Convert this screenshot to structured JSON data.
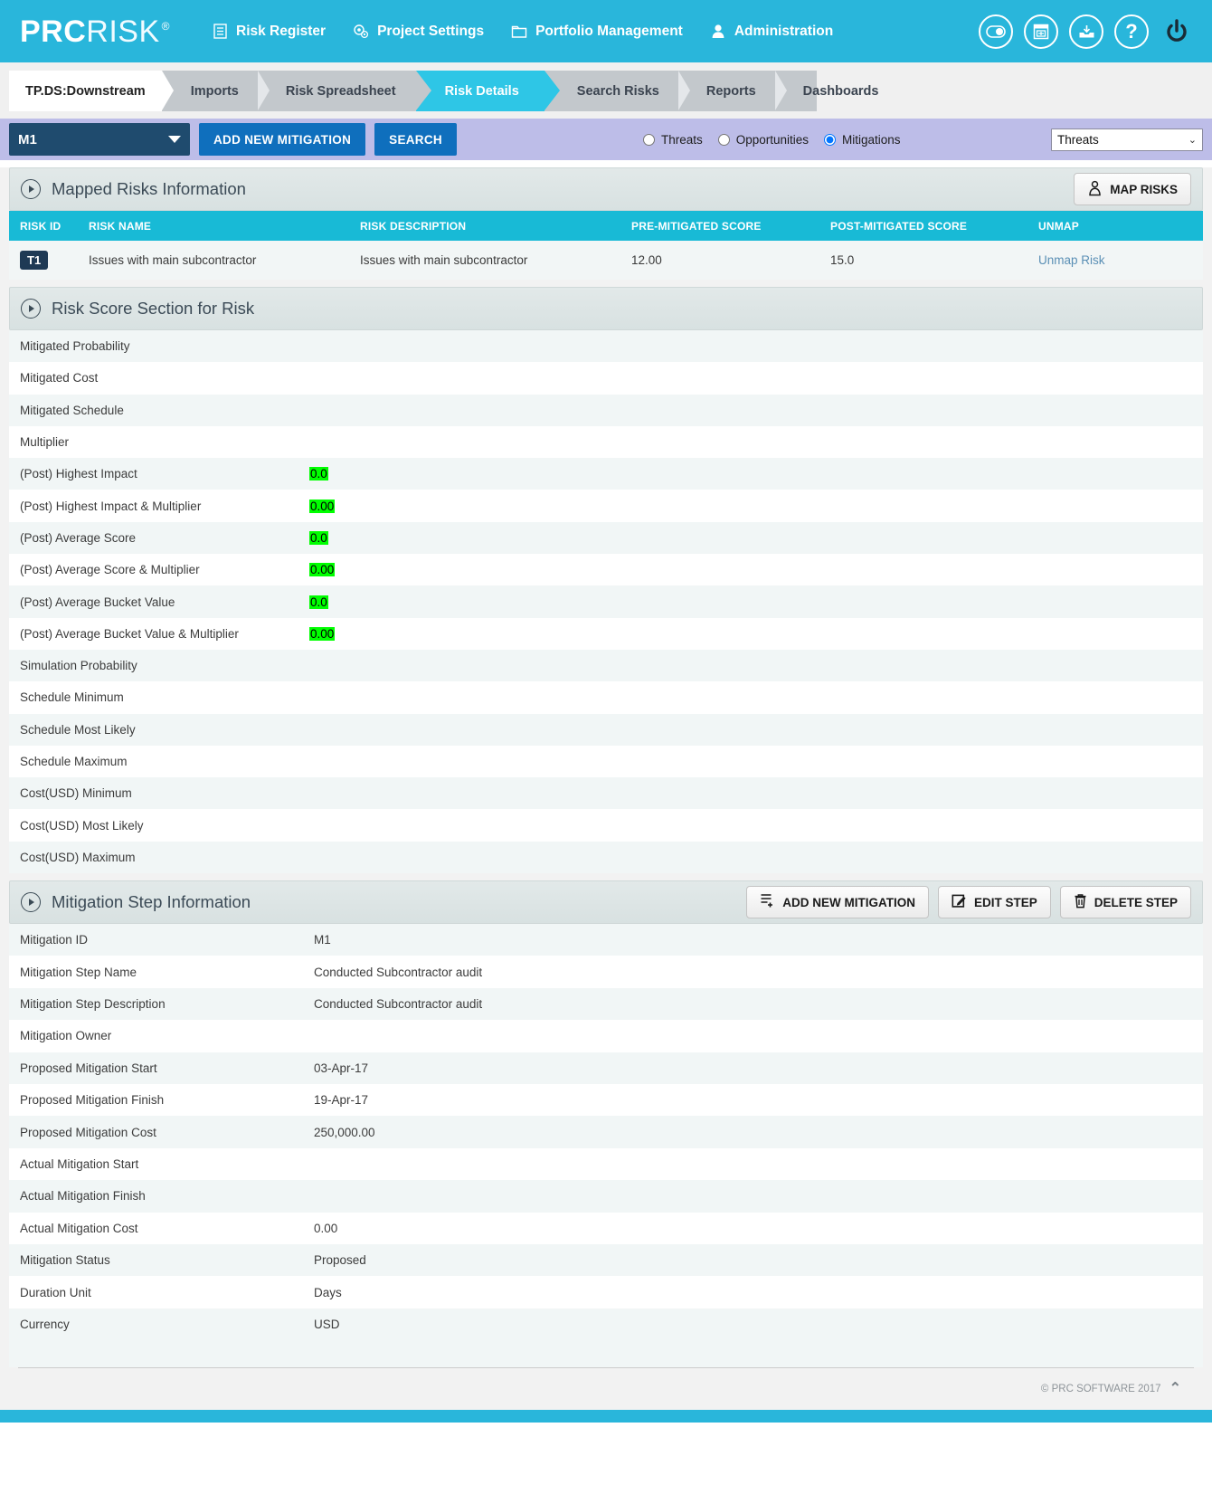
{
  "header": {
    "brand_bold": "PRC",
    "brand_light": "RISK",
    "brand_reg": "®",
    "nav": [
      {
        "label": "Risk Register",
        "icon": "list-document-icon"
      },
      {
        "label": "Project Settings",
        "icon": "settings-gear-icon"
      },
      {
        "label": "Portfolio Management",
        "icon": "folder-icon"
      },
      {
        "label": "Administration",
        "icon": "user-icon"
      }
    ],
    "right_icons": [
      {
        "name": "toggle-switch-icon"
      },
      {
        "name": "calendar-window-icon"
      },
      {
        "name": "inbox-download-icon"
      },
      {
        "name": "help-question-icon"
      },
      {
        "name": "power-logout-icon"
      }
    ]
  },
  "tabs": {
    "project": "TP.DS:Downstream",
    "items": [
      {
        "label": "Imports",
        "active": false
      },
      {
        "label": "Risk Spreadsheet",
        "active": false
      },
      {
        "label": "Risk Details",
        "active": true
      },
      {
        "label": "Search Risks",
        "active": false
      },
      {
        "label": "Reports",
        "active": false
      },
      {
        "label": "Dashboards",
        "active": false
      }
    ]
  },
  "actionbar": {
    "mitigation_selected": "M1",
    "add_new_mitigation": "ADD NEW MITIGATION",
    "search": "SEARCH",
    "radios": [
      {
        "label": "Threats",
        "checked": false
      },
      {
        "label": "Opportunities",
        "checked": false
      },
      {
        "label": "Mitigations",
        "checked": true
      }
    ],
    "filter_selected": "Threats"
  },
  "mapped_risks": {
    "title": "Mapped Risks Information",
    "map_risks_button": "MAP RISKS",
    "columns": [
      "RISK ID",
      "RISK NAME",
      "RISK DESCRIPTION",
      "PRE-MITIGATED SCORE",
      "POST-MITIGATED SCORE",
      "UNMAP"
    ],
    "rows": [
      {
        "risk_id": "T1",
        "risk_name": "Issues with main subcontractor",
        "risk_description": "Issues with main subcontractor",
        "pre_mitigated_score": "12.00",
        "post_mitigated_score": "15.0",
        "unmap": "Unmap Risk"
      }
    ]
  },
  "risk_score_section": {
    "title": "Risk Score Section for Risk",
    "rows": [
      {
        "label": "Mitigated Probability",
        "value": "",
        "highlight": false
      },
      {
        "label": "Mitigated Cost",
        "value": "",
        "highlight": false
      },
      {
        "label": "Mitigated Schedule",
        "value": "",
        "highlight": false
      },
      {
        "label": "Multiplier",
        "value": "",
        "highlight": false
      },
      {
        "label": "(Post) Highest Impact",
        "value": "0.0",
        "highlight": true
      },
      {
        "label": "(Post) Highest Impact & Multiplier",
        "value": "0.00",
        "highlight": true
      },
      {
        "label": "(Post) Average Score",
        "value": "0.0",
        "highlight": true
      },
      {
        "label": "(Post) Average Score & Multiplier",
        "value": "0.00",
        "highlight": true
      },
      {
        "label": "(Post) Average Bucket Value",
        "value": "0.0",
        "highlight": true
      },
      {
        "label": "(Post) Average Bucket Value & Multiplier",
        "value": "0.00",
        "highlight": true
      },
      {
        "label": "Simulation Probability",
        "value": "",
        "highlight": false
      },
      {
        "label": "Schedule Minimum",
        "value": "",
        "highlight": false
      },
      {
        "label": "Schedule Most Likely",
        "value": "",
        "highlight": false
      },
      {
        "label": "Schedule Maximum",
        "value": "",
        "highlight": false
      },
      {
        "label": "Cost(USD) Minimum",
        "value": "",
        "highlight": false
      },
      {
        "label": "Cost(USD) Most Likely",
        "value": "",
        "highlight": false
      },
      {
        "label": "Cost(USD) Maximum",
        "value": "",
        "highlight": false
      }
    ]
  },
  "mitigation_step": {
    "title": "Mitigation Step Information",
    "buttons": [
      {
        "label": "ADD NEW MITIGATION",
        "icon": "add-document-icon"
      },
      {
        "label": "EDIT STEP",
        "icon": "edit-pencil-icon"
      },
      {
        "label": "DELETE STEP",
        "icon": "trash-icon"
      }
    ],
    "rows": [
      {
        "label": "Mitigation ID",
        "value": "M1"
      },
      {
        "label": "Mitigation Step Name",
        "value": "Conducted Subcontractor audit"
      },
      {
        "label": "Mitigation Step Description",
        "value": "Conducted Subcontractor audit"
      },
      {
        "label": "Mitigation Owner",
        "value": ""
      },
      {
        "label": "Proposed Mitigation Start",
        "value": "03-Apr-17"
      },
      {
        "label": "Proposed Mitigation Finish",
        "value": "19-Apr-17"
      },
      {
        "label": "Proposed Mitigation Cost",
        "value": "250,000.00"
      },
      {
        "label": "Actual Mitigation Start",
        "value": ""
      },
      {
        "label": "Actual Mitigation Finish",
        "value": ""
      },
      {
        "label": "Actual Mitigation Cost",
        "value": "0.00"
      },
      {
        "label": "Mitigation Status",
        "value": "Proposed"
      },
      {
        "label": "Duration Unit",
        "value": "Days"
      },
      {
        "label": "Currency",
        "value": "USD"
      }
    ]
  },
  "footer": {
    "copyright": "© PRC SOFTWARE 2017",
    "scroll_top": "⌃"
  },
  "colors": {
    "brand_cyan": "#29b6db",
    "table_header": "#18bad6",
    "accent_blue": "#0f6fbd",
    "select_navy": "#1f4b6e",
    "highlight_green": "#00ff00",
    "actionbar_purple": "#bdbde8"
  }
}
